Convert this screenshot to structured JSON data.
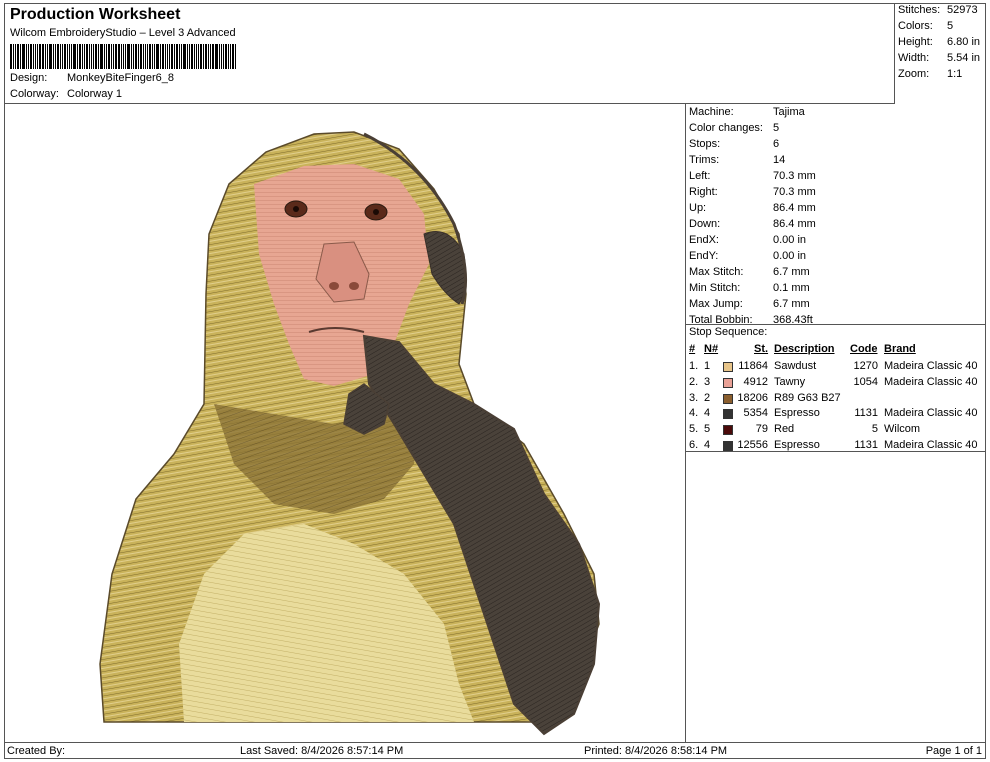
{
  "header": {
    "title": "Production Worksheet",
    "subtitle": "Wilcom EmbroideryStudio – Level 3 Advanced",
    "design_label": "Design:",
    "design_value": "MonkeyBiteFinger6_8",
    "colorway_label": "Colorway:",
    "colorway_value": "Colorway 1"
  },
  "stats": [
    {
      "label": "Stitches:",
      "value": "52973"
    },
    {
      "label": "Colors:",
      "value": "5"
    },
    {
      "label": "Height:",
      "value": "6.80 in"
    },
    {
      "label": "Width:",
      "value": "5.54 in"
    },
    {
      "label": "Zoom:",
      "value": "1:1"
    }
  ],
  "machine_info": [
    {
      "label": "Machine:",
      "value": "Tajima"
    },
    {
      "label": "Color changes:",
      "value": "5"
    },
    {
      "label": "Stops:",
      "value": "6"
    },
    {
      "label": "Trims:",
      "value": "14"
    },
    {
      "label": "Left:",
      "value": "70.3 mm"
    },
    {
      "label": "Right:",
      "value": "70.3 mm"
    },
    {
      "label": "Up:",
      "value": "86.4 mm"
    },
    {
      "label": "Down:",
      "value": "86.4 mm"
    },
    {
      "label": "EndX:",
      "value": "0.00 in"
    },
    {
      "label": "EndY:",
      "value": "0.00 in"
    },
    {
      "label": "Max Stitch:",
      "value": "6.7 mm"
    },
    {
      "label": "Min Stitch:",
      "value": "0.1 mm"
    },
    {
      "label": "Max Jump:",
      "value": "6.7 mm"
    },
    {
      "label": "Total Bobbin:",
      "value": "368.43ft"
    }
  ],
  "stop_sequence": {
    "label": "Stop Sequence:",
    "headers": {
      "num": "#",
      "ncol": "N#",
      "st": "St.",
      "description": "Description",
      "code": "Code",
      "brand": "Brand"
    },
    "rows": [
      {
        "num": "1.",
        "n": "1",
        "st": "11864",
        "color": "#e8c58a",
        "description": "Sawdust",
        "code": "1270",
        "brand": "Madeira Classic 40"
      },
      {
        "num": "2.",
        "n": "3",
        "st": "4912",
        "color": "#e9a196",
        "description": "Tawny",
        "code": "1054",
        "brand": "Madeira Classic 40"
      },
      {
        "num": "3.",
        "n": "2",
        "st": "18206",
        "color": "#8a5e2e",
        "description": "R89 G63 B27",
        "code": "",
        "brand": ""
      },
      {
        "num": "4.",
        "n": "4",
        "st": "5354",
        "color": "#333333",
        "description": "Espresso",
        "code": "1131",
        "brand": "Madeira Classic 40"
      },
      {
        "num": "5.",
        "n": "5",
        "st": "79",
        "color": "#4a0a0a",
        "description": "Red",
        "code": "5",
        "brand": "Wilcom"
      },
      {
        "num": "6.",
        "n": "4",
        "st": "12556",
        "color": "#333333",
        "description": "Espresso",
        "code": "1131",
        "brand": "Madeira Classic 40"
      }
    ]
  },
  "footer": {
    "created_by": "Created By:",
    "last_saved": "Last Saved: 8/4/2026 8:57:14 PM",
    "printed": "Printed: 8/4/2026 8:58:14 PM",
    "page": "Page 1 of 1"
  }
}
